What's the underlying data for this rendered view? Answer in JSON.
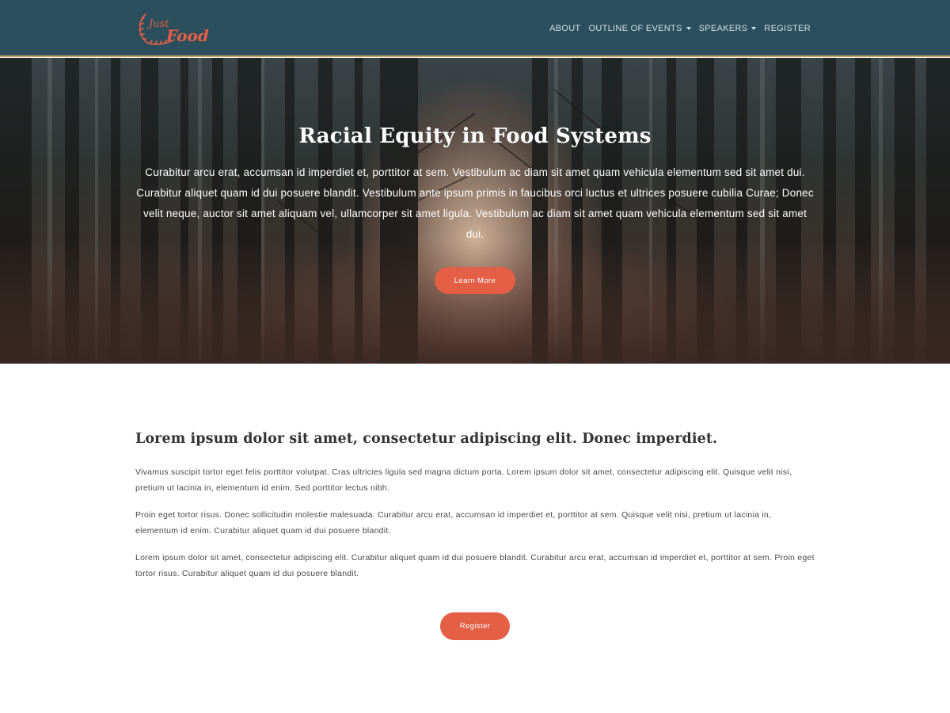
{
  "brand": {
    "logo_text_1": "Just",
    "logo_text_2": "Food",
    "logo_color": "#e45f45"
  },
  "nav": {
    "items": [
      {
        "label": "ABOUT",
        "dropdown": false
      },
      {
        "label": "OUTLINE OF EVENTS",
        "dropdown": true
      },
      {
        "label": "SPEAKERS",
        "dropdown": true
      },
      {
        "label": "REGISTER",
        "dropdown": false
      }
    ]
  },
  "hero": {
    "title": "Racial Equity in Food Systems",
    "text": "Curabitur arcu erat, accumsan id imperdiet et, porttitor at sem. Vestibulum ac diam sit amet quam vehicula elementum sed sit amet dui. Curabitur aliquet quam id dui posuere blandit. Vestibulum ante ipsum primis in faucibus orci luctus et ultrices posuere cubilia Curae; Donec velit neque, auctor sit amet aliquam vel, ullamcorper sit amet ligula. Vestibulum ac diam sit amet quam vehicula elementum sed sit amet dui.",
    "button_label": "Learn More"
  },
  "main": {
    "heading": "Lorem ipsum dolor sit amet, consectetur adipiscing elit. Donec imperdiet.",
    "paragraphs": [
      "Vivamus suscipit tortor eget felis porttitor volutpat. Cras ultricies ligula sed magna dictum porta. Lorem ipsum dolor sit amet, consectetur adipiscing elit. Quisque velit nisi, pretium ut lacinia in, elementum id enim. Sed porttitor lectus nibh.",
      "Proin eget tortor risus. Donec sollicitudin molestie malesuada. Curabitur arcu erat, accumsan id imperdiet et, porttitor at sem. Quisque velit nisi, pretium ut lacinia in, elementum id enim. Curabitur aliquet quam id dui posuere blandit.",
      "Lorem ipsum dolor sit amet, consectetur adipiscing elit. Curabitur aliquet quam id dui posuere blandit. Curabitur arcu erat, accumsan id imperdiet et, porttitor at sem. Proin eget tortor risus. Curabitur aliquet quam id dui posuere blandit."
    ],
    "register_label": "Register"
  },
  "colors": {
    "navbar": "#2c4f5d",
    "navbar_border": "#c9a46a",
    "accent": "#e45f45"
  }
}
